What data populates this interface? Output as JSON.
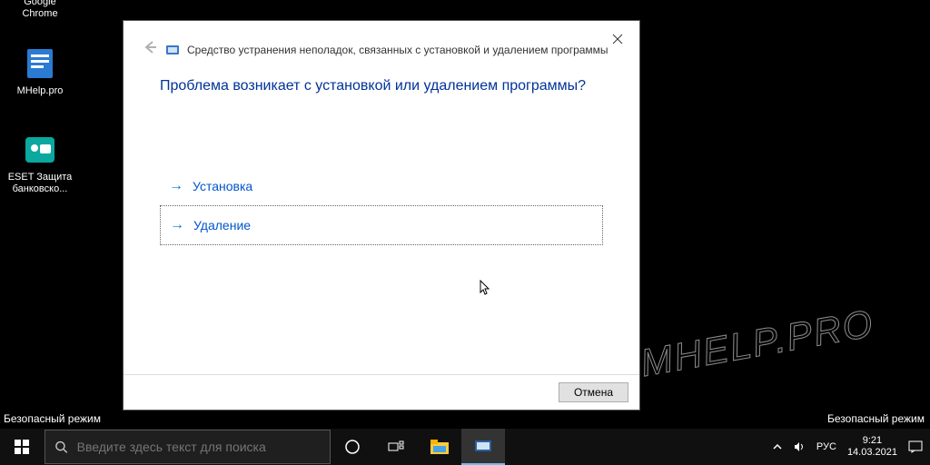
{
  "desktop": {
    "icons": [
      {
        "label": "Google Chrome"
      },
      {
        "label": "MHelp.pro"
      },
      {
        "label": "ESET Защита банковско..."
      }
    ]
  },
  "safe_mode_label": "Безопасный режим",
  "dialog": {
    "title": "Средство устранения неполадок, связанных с установкой и удалением программы",
    "question": "Проблема возникает с установкой или удалением программы?",
    "options": {
      "install": "Установка",
      "uninstall": "Удаление"
    },
    "cancel": "Отмена"
  },
  "watermark": "MHELP.PRO",
  "taskbar": {
    "search_placeholder": "Введите здесь текст для поиска",
    "lang": "РУС",
    "clock": {
      "time": "9:21",
      "date": "14.03.2021"
    }
  }
}
